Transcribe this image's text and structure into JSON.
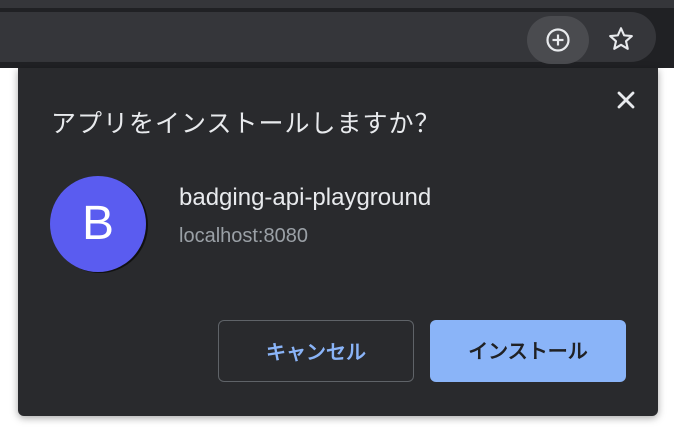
{
  "toolbar": {
    "install_icon": "plus-circle-icon",
    "bookmark_icon": "star-icon"
  },
  "dialog": {
    "title": "アプリをインストールしますか？",
    "close_icon": "close-icon",
    "app": {
      "initial": "B",
      "name": "badging-api-playground",
      "origin": "localhost:8080"
    },
    "cancel_label": "キャンセル",
    "install_label": "インストール"
  },
  "colors": {
    "toolbar_bg": "#202124",
    "omnibox_bg": "#35363a",
    "dialog_bg": "#292a2d",
    "avatar_bg": "#5a5cf0",
    "accent": "#8ab4f8"
  }
}
